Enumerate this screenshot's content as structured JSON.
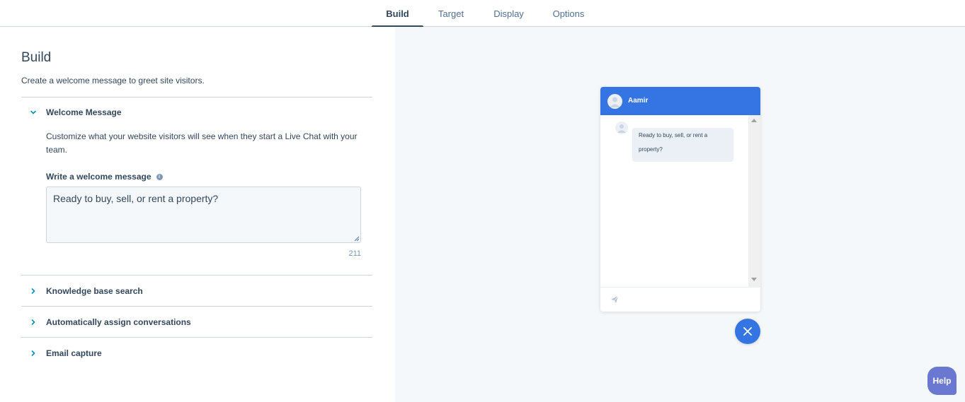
{
  "tabs": [
    {
      "label": "Build",
      "active": true
    },
    {
      "label": "Target",
      "active": false
    },
    {
      "label": "Display",
      "active": false
    },
    {
      "label": "Options",
      "active": false
    }
  ],
  "build": {
    "title": "Build",
    "description": "Create a welcome message to greet site visitors.",
    "sections": [
      {
        "label": "Welcome Message",
        "expanded": true
      },
      {
        "label": "Knowledge base search",
        "expanded": false
      },
      {
        "label": "Automatically assign conversations",
        "expanded": false
      },
      {
        "label": "Email capture",
        "expanded": false
      }
    ],
    "welcome": {
      "description": "Customize what your website visitors will see when they start a Live Chat with your team.",
      "field_label": "Write a welcome message",
      "value": "Ready to buy, sell, or rent a property?",
      "char_count": "211"
    }
  },
  "preview": {
    "agent_name": "Aamir",
    "message": "Ready to buy, sell, or rent a property?",
    "header_color": "#3574e3"
  },
  "help": {
    "label": "Help"
  },
  "colors": {
    "accent": "#0091ae",
    "brand_blue": "#3574e3",
    "help_purple": "#6a78d1",
    "text": "#33475b"
  }
}
